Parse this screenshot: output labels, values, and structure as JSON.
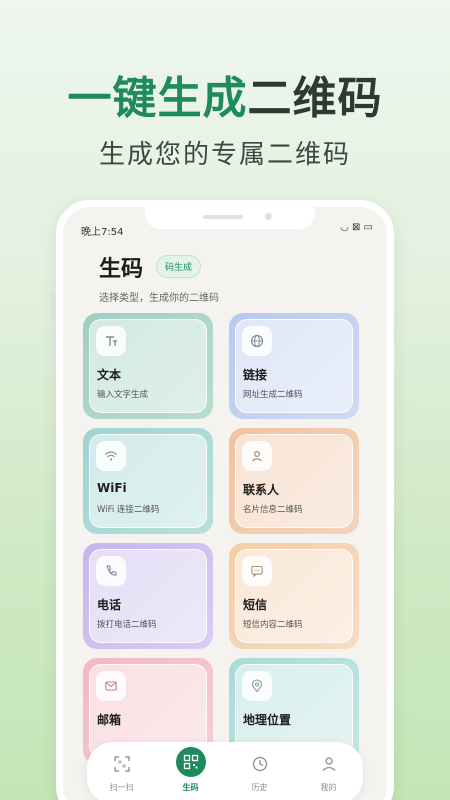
{
  "promo": {
    "title_green": "一键生成",
    "title_dark": "二维码",
    "subtitle": "生成您的专属二维码"
  },
  "status": {
    "time": "晚上7:54",
    "icons": "◡ ⊠ ▭"
  },
  "header": {
    "title": "生码",
    "badge": "码生成",
    "subtitle": "选择类型，生成你的二维码"
  },
  "cards": [
    {
      "label": "文本",
      "desc": "输入文字生成",
      "icon": "text-icon"
    },
    {
      "label": "链接",
      "desc": "网址生成二维码",
      "icon": "globe-icon"
    },
    {
      "label": "WiFi",
      "desc": "WiFi 连接二维码",
      "icon": "wifi-icon"
    },
    {
      "label": "联系人",
      "desc": "名片信息二维码",
      "icon": "contact-icon"
    },
    {
      "label": "电话",
      "desc": "拨打电话二维码",
      "icon": "phone-icon"
    },
    {
      "label": "短信",
      "desc": "短信内容二维码",
      "icon": "message-icon"
    },
    {
      "label": "邮箱",
      "desc": "",
      "icon": "mail-icon"
    },
    {
      "label": "地理位置",
      "desc": "",
      "icon": "location-icon"
    }
  ],
  "tabs": [
    {
      "label": "扫一扫",
      "icon": "scan-icon"
    },
    {
      "label": "生码",
      "icon": "qr-icon"
    },
    {
      "label": "历史",
      "icon": "history-icon"
    },
    {
      "label": "我的",
      "icon": "user-icon"
    }
  ],
  "colors": {
    "accent": "#1f8a5c",
    "dark_text": "#2b3a33"
  }
}
